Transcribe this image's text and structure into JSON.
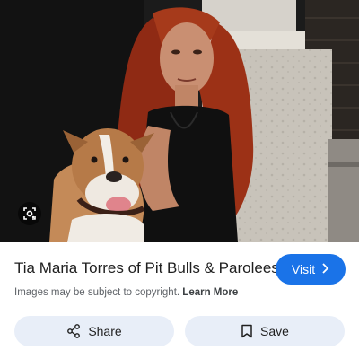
{
  "result": {
    "title": "Tia Maria Torres of Pit Bulls & Parolees",
    "visit_label": "Visit",
    "copyright_text": "Images may be subject to copyright.",
    "learn_more_label": "Learn More"
  },
  "actions": {
    "share_label": "Share",
    "save_label": "Save"
  },
  "icons": {
    "lens": "lens-icon",
    "visit": "chevron-right-icon",
    "share": "share-icon",
    "save": "bookmark-icon"
  },
  "colors": {
    "accent": "#1a73e8",
    "action_bg": "#e8eef8"
  }
}
